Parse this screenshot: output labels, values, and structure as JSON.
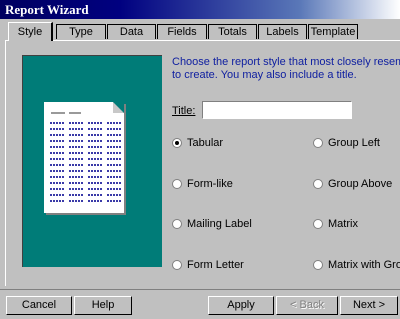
{
  "window": {
    "title": "Report Wizard"
  },
  "tabs": [
    "Style",
    "Type",
    "Data",
    "Fields",
    "Totals",
    "Labels",
    "Template"
  ],
  "description": [
    "Choose the report style that most closely resembles the repo",
    "to create. You may also include a title."
  ],
  "title_field": {
    "label": "Title:",
    "value": ""
  },
  "styles": {
    "left": [
      {
        "label": "Tabular",
        "selected": true
      },
      {
        "label": "Form-like",
        "selected": false
      },
      {
        "label": "Mailing Label",
        "selected": false
      },
      {
        "label": "Form Letter",
        "selected": false
      }
    ],
    "right": [
      {
        "label": "Group Left",
        "selected": false
      },
      {
        "label": "Group Above",
        "selected": false
      },
      {
        "label": "Matrix",
        "selected": false
      },
      {
        "label": "Matrix with Grou",
        "selected": false
      }
    ]
  },
  "buttons": {
    "cancel": "Cancel",
    "help": "Help",
    "apply": "Apply",
    "back": "< Back",
    "next": "Next >"
  },
  "colors": {
    "preview_bg": "#007c78",
    "description_text": "#1020a0",
    "titlebar": "#000080"
  }
}
